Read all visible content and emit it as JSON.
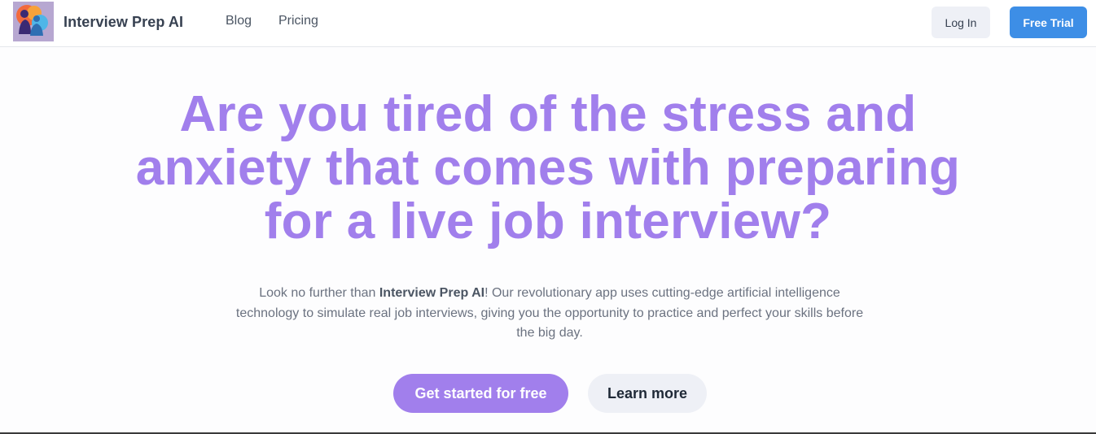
{
  "nav": {
    "brand": "Interview Prep AI",
    "links": [
      "Blog",
      "Pricing"
    ],
    "login_label": "Log In",
    "trial_label": "Free Trial"
  },
  "hero": {
    "title_lines": [
      "Are you tired of the stress and",
      "anxiety that comes with preparing",
      "for a live job interview?"
    ],
    "desc_prefix": "Look no further than ",
    "desc_brand": "Interview Prep AI",
    "desc_suffix": "! Our revolutionary app uses cutting-edge artificial intelligence technology to simulate real job interviews, giving you the opportunity to practice and perfect your skills before the big day.",
    "primary_cta": "Get started for free",
    "secondary_cta": "Learn more"
  },
  "colors": {
    "accent": "#a17fec",
    "primary_blue": "#3d8ee6",
    "button_gray": "#eef0f6"
  },
  "icons": {
    "logo": "interview-people-logo"
  }
}
